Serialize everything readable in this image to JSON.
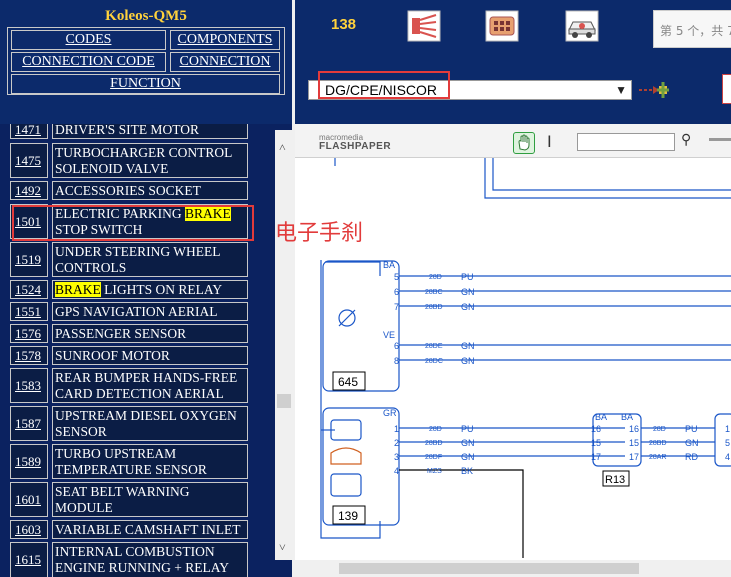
{
  "app": {
    "title": "Koleos-QM5"
  },
  "nav": {
    "codes": "CODES",
    "components": "COMPONENTS",
    "connection_code": "CONNECTION CODE",
    "connection": "CONNECTION",
    "function": "FUNCTION"
  },
  "list": [
    {
      "num": "1471",
      "desc": "DRIVER'S SITE MOTOR"
    },
    {
      "num": "1475",
      "desc": "TURBOCHARGER CONTROL\nSOLENOID VALVE"
    },
    {
      "num": "1492",
      "desc": "ACCESSORIES SOCKET"
    },
    {
      "num": "1501",
      "desc_pre": "ELECTRIC PARKING ",
      "desc_hl": "BRAKE",
      "desc_post": "\nSTOP SWITCH"
    },
    {
      "num": "1519",
      "desc": "UNDER STEERING WHEEL\nCONTROLS"
    },
    {
      "num": "1524",
      "desc_hl": "BRAKE",
      "desc_post": " LIGHTS ON RELAY"
    },
    {
      "num": "1551",
      "desc": "GPS NAVIGATION AERIAL"
    },
    {
      "num": "1576",
      "desc": "PASSENGER SENSOR"
    },
    {
      "num": "1578",
      "desc": "SUNROOF MOTOR"
    },
    {
      "num": "1583",
      "desc": "REAR BUMPER HANDS-FREE\nCARD DETECTION AERIAL"
    },
    {
      "num": "1587",
      "desc": "UPSTREAM DIESEL OXYGEN\nSENSOR"
    },
    {
      "num": "1589",
      "desc": "TURBO UPSTREAM\nTEMPERATURE SENSOR"
    },
    {
      "num": "1601",
      "desc": "SEAT BELT WARNING\nMODULE"
    },
    {
      "num": "1603",
      "desc": "VARIABLE CAMSHAFT INLET"
    },
    {
      "num": "1615",
      "desc": "INTERNAL COMBUSTION\nENGINE RUNNING + RELAY"
    }
  ],
  "toolbar": {
    "page_number": "138",
    "search_text": "第 5 个，共 7",
    "select_value": "DG/CPE/NISCOR"
  },
  "viewer": {
    "logo_small": "macromedia",
    "logo": "FLASHPAPER"
  },
  "annotation": "电子手刹",
  "diagram": {
    "conn_ba": "BA",
    "conn_ve": "VE",
    "conn_gr": "GR",
    "box_645": "645",
    "box_139": "139",
    "box_r13": "R13",
    "ba_pins": [
      "5",
      "6",
      "7"
    ],
    "ba_wires": [
      "28D",
      "28BC",
      "28BD"
    ],
    "ba_colors": [
      "PU",
      "GN",
      "GN"
    ],
    "ve_pins": [
      "6",
      "8"
    ],
    "ve_wires": [
      "28DE",
      "28DC"
    ],
    "ve_colors": [
      "GN",
      "GN"
    ],
    "gr_pins": [
      "1",
      "2",
      "3",
      "4"
    ],
    "gr_wires": [
      "28D",
      "28BD",
      "28DF",
      "MZS"
    ],
    "gr_colors": [
      "PU",
      "GN",
      "GN",
      "BK"
    ],
    "r13_left": [
      "16",
      "15",
      "17"
    ],
    "r13_right": [
      "16",
      "15",
      "17"
    ],
    "r13_wires": [
      "28D",
      "28BD",
      "28AR"
    ],
    "r13_colors": [
      "PU",
      "GN",
      "RD"
    ],
    "far_pins": [
      "1",
      "5",
      "4"
    ]
  },
  "colors": {
    "panel": "#0b2260",
    "title": "#ffd23c",
    "highlight": "#ffff00",
    "annot": "#e23b3b",
    "wire": "#1a56c8"
  }
}
